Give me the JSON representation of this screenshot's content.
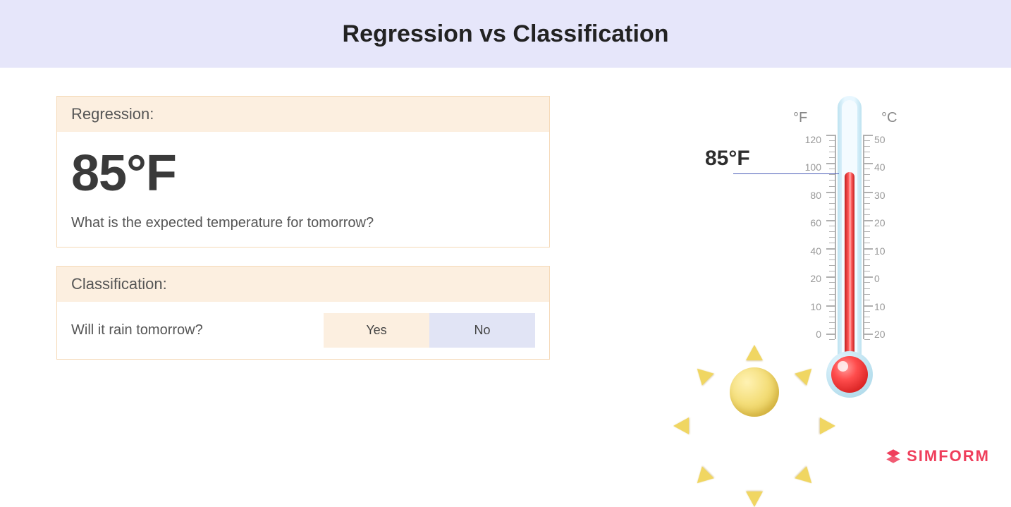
{
  "title": "Regression vs Classification",
  "regression": {
    "label": "Regression:",
    "value": "85°F",
    "question": "What is the expected temperature for tomorrow?"
  },
  "classification": {
    "label": "Classification:",
    "question": "Will it rain tomorrow?",
    "options": {
      "yes": "Yes",
      "no": "No"
    }
  },
  "thermo": {
    "unit_f": "°F",
    "unit_c": "°C",
    "marker": "85°F",
    "scale_f": [
      "120",
      "100",
      "80",
      "60",
      "40",
      "20",
      "10",
      "0"
    ],
    "scale_c": [
      "50",
      "40",
      "30",
      "20",
      "10",
      "0",
      "10",
      "20"
    ]
  },
  "logo": "SIMFORM"
}
